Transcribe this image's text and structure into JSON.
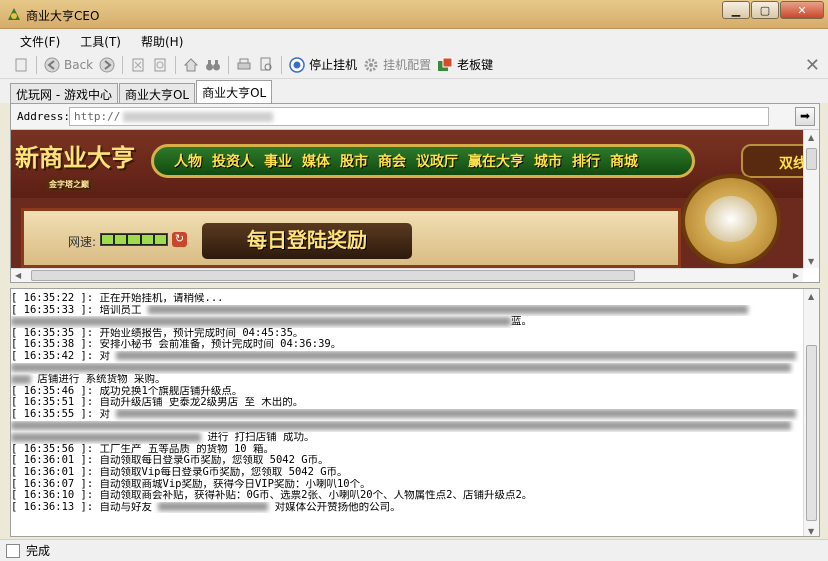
{
  "window": {
    "title": "商业大亨CEO"
  },
  "menu": [
    "文件(F)",
    "工具(T)",
    "帮助(H)"
  ],
  "toolbar": {
    "back": "Back",
    "stop_hangup": "停止挂机",
    "hangup_config": "挂机配置",
    "boss_key": "老板键"
  },
  "tabs": [
    "优玩网 - 游戏中心",
    "商业大亨OL",
    "商业大亨OL"
  ],
  "address": {
    "label": "Address:",
    "value": "http://"
  },
  "game": {
    "logo_text": "新商业大亨",
    "logo_sub": "金字塔之巅",
    "nav": [
      "人物",
      "投资人",
      "事业",
      "媒体",
      "股市",
      "商会",
      "议政厅",
      "赢在大亨",
      "城市",
      "排行",
      "商城"
    ],
    "right_tag": "双线",
    "speed_label": "网速:",
    "speed_segments": 5,
    "daily_banner": "每日登陆奖励"
  },
  "log": [
    {
      "time": "[ 16:35:22 ]:",
      "msg": "正在开始挂机，请稍候..."
    },
    {
      "time": "[ 16:35:33 ]:",
      "msg": "培训员工"
    },
    {
      "time": "",
      "msg": "蓝。"
    },
    {
      "time": "[ 16:35:35 ]:",
      "msg": "开始业绩报告，预计完成时间 04:45:35。"
    },
    {
      "time": "[ 16:35:38 ]:",
      "msg": "安排小秘书 会前准备，预计完成时间 04:36:39。"
    },
    {
      "time": "[ 16:35:42 ]:",
      "msg": "对"
    },
    {
      "time": "",
      "msg": "店铺进行 系统货物 采购。"
    },
    {
      "time": "[ 16:35:46 ]:",
      "msg": "成功兑换1个旗舰店铺升级点。"
    },
    {
      "time": "[ 16:35:51 ]:",
      "msg": "自动升级店铺 史泰龙2级男店 至 木出的。"
    },
    {
      "time": "[ 16:35:55 ]:",
      "msg": "对"
    },
    {
      "time": "",
      "msg": "进行 打扫店铺 成功。"
    },
    {
      "time": "[ 16:35:56 ]:",
      "msg": "工厂生产 五等品质 的货物 10 箱。"
    },
    {
      "time": "[ 16:36:01 ]:",
      "msg": "自动领取每日登录G币奖励，您领取 5042 G币。"
    },
    {
      "time": "[ 16:36:01 ]:",
      "msg": "自动领取Vip每日登录G币奖励，您领取 5042 G币。"
    },
    {
      "time": "[ 16:36:07 ]:",
      "msg": "自动领取商城Vip奖励，获得今日VIP奖励：小喇叭10个。"
    },
    {
      "time": "[ 16:36:10 ]:",
      "msg": "自动领取商会补贴，获得补贴：0G币、选票2张、小喇叭20个、人物属性点2、店铺升级点2。"
    },
    {
      "time": "[ 16:36:13 ]:",
      "msg": "自动与好友"
    },
    {
      "time": "",
      "msg": "对媒体公开赞扬他的公司。"
    }
  ],
  "status": {
    "text": "完成"
  }
}
